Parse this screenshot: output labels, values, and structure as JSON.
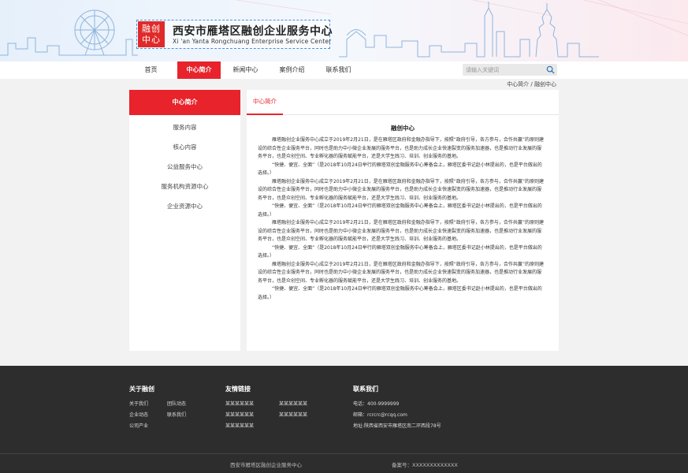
{
  "header": {
    "logo_badge": "融创中心",
    "title_cn": "西安市雁塔区融创企业服务中心",
    "title_en": "Xi 'an Yanta Rongchuang Enterprise Service Center"
  },
  "nav": {
    "items": [
      {
        "label": "首页"
      },
      {
        "label": "中心简介"
      },
      {
        "label": "新闻中心"
      },
      {
        "label": "案例介绍"
      },
      {
        "label": "联系我们"
      }
    ],
    "active": "中心简介",
    "search_placeholder": "请输入关键词"
  },
  "breadcrumb": "中心简介 / 融创中心",
  "sidebar": {
    "heading": "中心简介",
    "items": [
      {
        "label": "服务内容"
      },
      {
        "label": "核心内容"
      },
      {
        "label": "公益服务中心"
      },
      {
        "label": "服务机构资源中心"
      },
      {
        "label": "企业资源中心"
      }
    ]
  },
  "main": {
    "tab": "中心简介",
    "article_title": "融创中心",
    "paragraphs": [
      "雁塔融创企业服务中心成立于2019年2月21日，是在雁塔区政府和金融办指导下，按照“政府引导，各方参与，合作共赢”的原则建设的综合性企业服务平台，同时也是助力中小微企业发展的服务平台，也是助力成长企业快速裂变的服务加速器，也是推动行业发展的服务平台，也是众创空间、专业孵化器的服务赋能平台，还是大学生践习、培训、创业服务的基地。",
      "“快捷、便宜、全面”（是2018年10月24日举行的雁塔双创金融服务中心筹备会上，雁塔区委书记赵小林提出的，也是平台做出的选择。）",
      "雁塔融创企业服务中心成立于2019年2月21日，是在雁塔区政府和金融办指导下，按照“政府引导，各方参与，合作共赢”的原则建设的综合性企业服务平台，同时也是助力中小微企业发展的服务平台，也是助力成长企业快速裂变的服务加速器，也是推动行业发展的服务平台，也是众创空间、专业孵化器的服务赋能平台，还是大学生践习、培训、创业服务的基地。",
      "“快捷、便宜、全面”（是2018年10月24日举行的雁塔双创金融服务中心筹备会上，雁塔区委书记赵小林提出的，也是平台做出的选择。）",
      "雁塔融创企业服务中心成立于2019年2月21日，是在雁塔区政府和金融办指导下，按照“政府引导，各方参与，合作共赢”的原则建设的综合性企业服务平台，同时也是助力中小微企业发展的服务平台，也是助力成长企业快速裂变的服务加速器，也是推动行业发展的服务平台，也是众创空间、专业孵化器的服务赋能平台，还是大学生践习、培训、创业服务的基地。",
      "“快捷、便宜、全面”（是2018年10月24日举行的雁塔双创金融服务中心筹备会上，雁塔区委书记赵小林提出的，也是平台做出的选择。）",
      "雁塔融创企业服务中心成立于2019年2月21日，是在雁塔区政府和金融办指导下，按照“政府引导，各方参与，合作共赢”的原则建设的综合性企业服务平台，同时也是助力中小微企业发展的服务平台，也是助力成长企业快速裂变的服务加速器，也是推动行业发展的服务平台，也是众创空间、专业孵化器的服务赋能平台，还是大学生践习、培训、创业服务的基地。",
      "“快捷、便宜、全面”（是2018年10月24日举行的雁塔双创金融服务中心筹备会上，雁塔区委书记赵小林提出的，也是平台做出的选择。）"
    ]
  },
  "footer": {
    "about": {
      "title": "关于融创",
      "links": [
        "关于我们",
        "团队动态",
        "企业动态",
        "联系我们",
        "公司产业"
      ]
    },
    "friends": {
      "title": "友情链接",
      "links": [
        "某某某某某某",
        "某某某某某某",
        "某某某某某某",
        "某某某某某某",
        "某某某某某某"
      ]
    },
    "contact": {
      "title": "联系我们",
      "phone": "电话：400-9999999",
      "email": "邮箱：rcrcrc@rcqq.com",
      "address": "地址:陕西省西安市雁塔区南二环西段78号"
    },
    "copyright": "西安市雁塔区融创企业服务中心",
    "icp": "备案号：XXXXXXXXXXXXX"
  },
  "colors": {
    "accent": "#e8232b",
    "footer_bg": "#2d2d2d",
    "page_bg": "#f2f2f2"
  }
}
